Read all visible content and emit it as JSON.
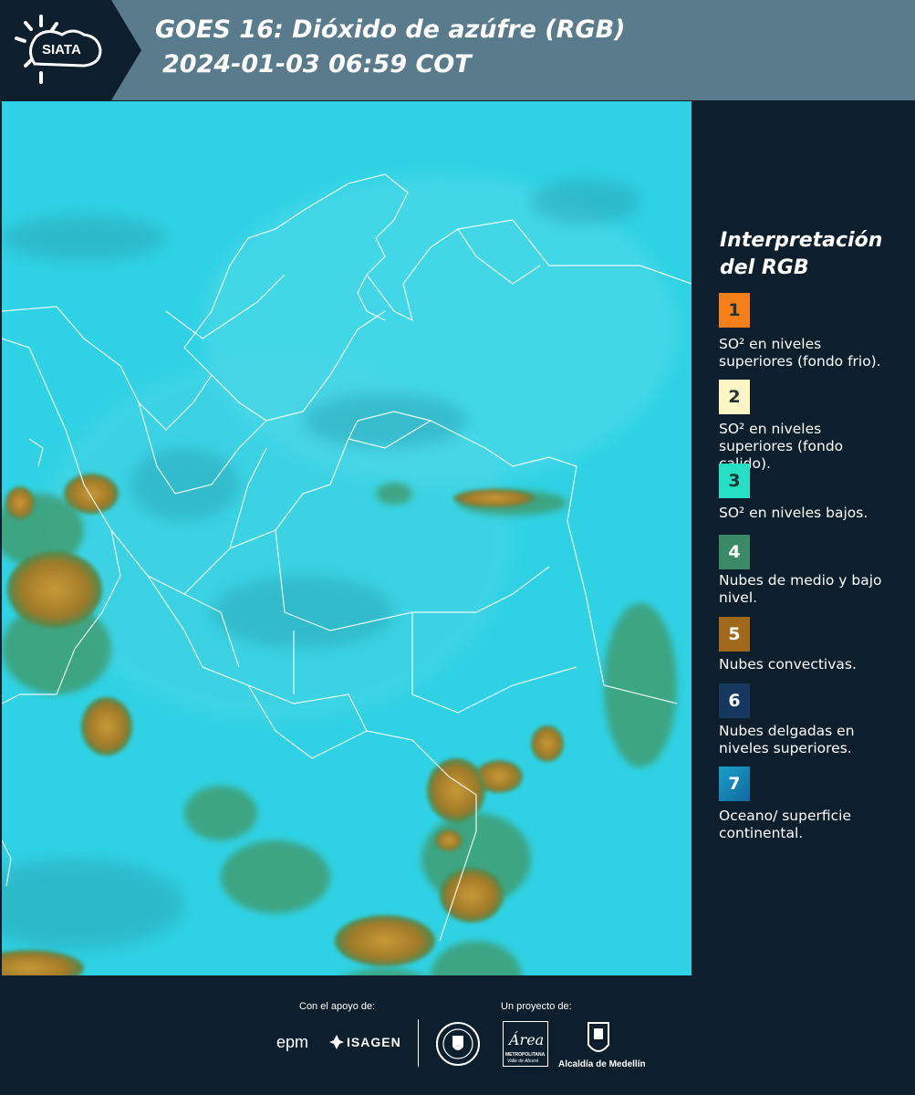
{
  "header": {
    "title_line1": "GOES 16: Dióxido de azúfre (RGB)",
    "title_line2": "2024-01-03 06:59 COT",
    "logo_text": "SIATA"
  },
  "legend": {
    "title": "Interpretación del RGB",
    "items": [
      {
        "number": "1",
        "color": "#f7801b",
        "label": "SO² en niveles superiores (fondo frio)."
      },
      {
        "number": "2",
        "color": "#fdf6c4",
        "label": "SO² en niveles superiores (fondo calido)."
      },
      {
        "number": "3",
        "color": "#25e0c4",
        "label": "SO² en niveles bajos."
      },
      {
        "number": "4",
        "color": "#3a8a68",
        "label": "Nubes de medio y bajo nivel."
      },
      {
        "number": "5",
        "color": "#a06a1a",
        "label": "Nubes convectivas."
      },
      {
        "number": "6",
        "color": "#17385e",
        "label": "Nubes delgadas en niveles superiores."
      },
      {
        "number": "7",
        "color": "#1aa0c8",
        "label": "Oceano/ superficie continental."
      }
    ]
  },
  "footer": {
    "support_label": "Con el apoyo de:",
    "project_label": "Un proyecto de:",
    "sponsor1": "epm",
    "sponsor2": "ISAGEN",
    "partner_area": "Área",
    "partner_area_sub": "METROPOLITANA",
    "partner_area_sub2": "Valle de Aburrá",
    "partner_alcaldia": "Alcaldía de Medellín"
  },
  "colors": {
    "background": "#0d1f2d",
    "header_band": "#5a7b8c",
    "sea_cyan": "#2ad4e6",
    "cloud_brown": "#9a7a2a"
  }
}
